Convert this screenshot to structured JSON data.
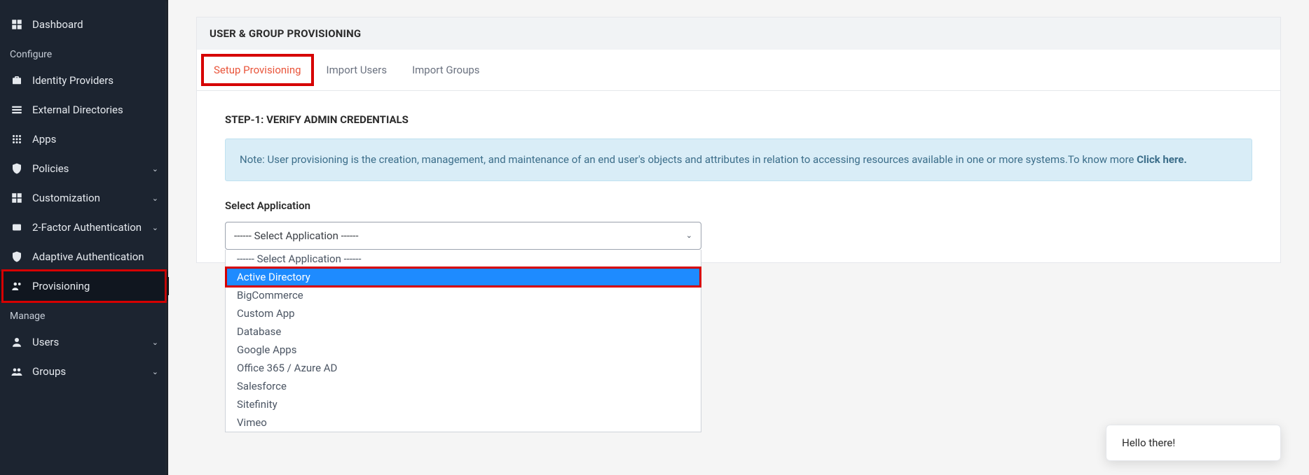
{
  "sidebar": {
    "dashboard": "Dashboard",
    "section_configure": "Configure",
    "identity_providers": "Identity Providers",
    "external_directories": "External Directories",
    "apps": "Apps",
    "policies": "Policies",
    "customization": "Customization",
    "two_factor": "2-Factor Authentication",
    "adaptive_auth": "Adaptive Authentication",
    "provisioning": "Provisioning",
    "section_manage": "Manage",
    "users": "Users",
    "groups": "Groups"
  },
  "panel": {
    "title": "USER & GROUP PROVISIONING",
    "tabs": {
      "setup": "Setup Provisioning",
      "import_users": "Import Users",
      "import_groups": "Import Groups"
    },
    "step_title": "STEP-1: VERIFY ADMIN CREDENTIALS",
    "note_prefix": "Note: User provisioning is the creation, management, and maintenance of an end user's objects and attributes in relation to accessing resources available in one or more systems.To know more ",
    "note_link": "Click here.",
    "field_label": "Select Application",
    "select_placeholder": "------ Select Application ------",
    "options": [
      "------ Select Application ------",
      "Active Directory",
      "BigCommerce",
      "Custom App",
      "Database",
      "Google Apps",
      "Office 365 / Azure AD",
      "Salesforce",
      "Sitefinity",
      "Vimeo"
    ]
  },
  "chat": {
    "greeting": "Hello there!"
  }
}
